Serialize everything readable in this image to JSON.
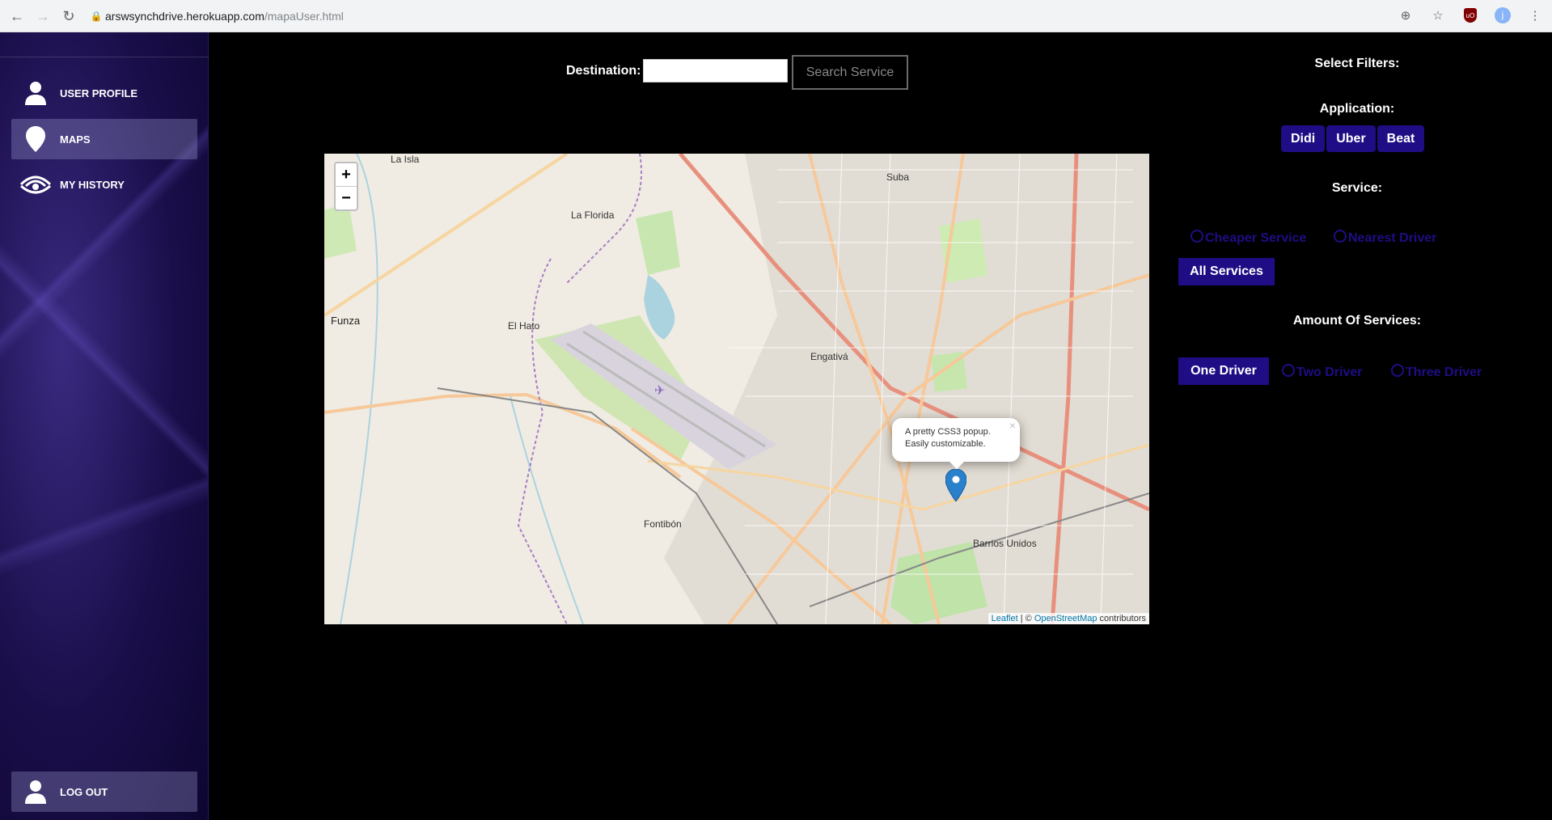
{
  "browser": {
    "host": "arswsynchdrive.herokuapp.com",
    "path": "/mapaUser.html",
    "profile_initial": "j"
  },
  "sidebar": {
    "items": [
      {
        "label": "USER PROFILE",
        "icon": "user-icon"
      },
      {
        "label": "MAPS",
        "icon": "map-pin-icon",
        "active": true
      },
      {
        "label": "MY HISTORY",
        "icon": "wifi-eye-icon"
      }
    ],
    "logout_label": "LOG OUT"
  },
  "search": {
    "destination_label": "Destination:",
    "destination_value": "",
    "button_label": "Search Service"
  },
  "map": {
    "zoom_in": "+",
    "zoom_out": "−",
    "places": [
      "La Isla",
      "La Florida",
      "Suba",
      "Funza",
      "El Hato",
      "Engativá",
      "Fontibón",
      "Barrios Unidos"
    ],
    "popup_text_1": "A pretty CSS3 popup.",
    "popup_text_2": "Easily customizable.",
    "popup_close": "×",
    "attribution_leaflet": "Leaflet",
    "attribution_sep": " | © ",
    "attribution_osm": "OpenStreetMap",
    "attribution_tail": " contributors"
  },
  "filters": {
    "title": "Select Filters:",
    "application_title": "Application:",
    "applications": [
      "Didi",
      "Uber",
      "Beat"
    ],
    "service_title": "Service:",
    "service_options": [
      "Cheaper Service",
      "Nearest Driver"
    ],
    "all_services_label": "All Services",
    "amount_title": "Amount Of Services:",
    "one_driver_label": "One Driver",
    "amount_options": [
      "Two Driver",
      "Three Driver"
    ]
  },
  "colors": {
    "accent": "#1e0d85",
    "sidebar_bg": "#1a0e4a",
    "page_bg": "#000000"
  }
}
